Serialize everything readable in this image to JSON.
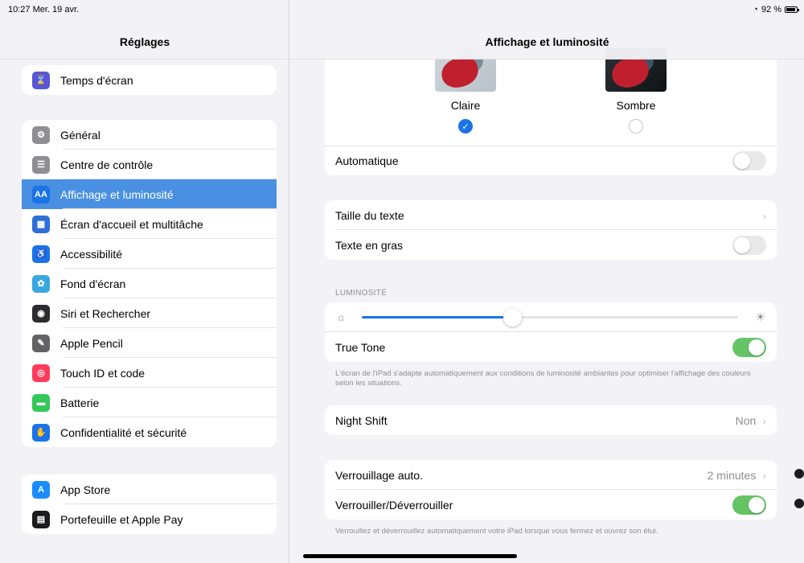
{
  "status": {
    "time": "10:27",
    "date": "Mer. 19 avr.",
    "battery": "92 %"
  },
  "sidebar": {
    "title": "Réglages",
    "groups": [
      {
        "items": [
          {
            "label": "Temps d'écran",
            "icon": "hourglass-icon",
            "color": "#5856d6",
            "glyph": "⌛"
          }
        ]
      },
      {
        "items": [
          {
            "label": "Général",
            "icon": "gear-icon",
            "color": "#8e8e93",
            "glyph": "⚙"
          },
          {
            "label": "Centre de contrôle",
            "icon": "control-center-icon",
            "color": "#8e8e93",
            "glyph": "☰"
          },
          {
            "label": "Affichage et luminosité",
            "icon": "display-icon",
            "color": "#1a73e8",
            "glyph": "AA"
          },
          {
            "label": "Écran d'accueil et multitâche",
            "icon": "home-screen-icon",
            "color": "#2f6fd8",
            "glyph": "▦"
          },
          {
            "label": "Accessibilité",
            "icon": "accessibility-icon",
            "color": "#1a73e8",
            "glyph": "♿"
          },
          {
            "label": "Fond d'écran",
            "icon": "wallpaper-icon",
            "color": "#3aa8e0",
            "glyph": "✿"
          },
          {
            "label": "Siri et Rechercher",
            "icon": "siri-icon",
            "color": "#2c2c2e",
            "glyph": "◉"
          },
          {
            "label": "Apple Pencil",
            "icon": "pencil-icon",
            "color": "#636366",
            "glyph": "✎"
          },
          {
            "label": "Touch ID et code",
            "icon": "fingerprint-icon",
            "color": "#ff3b5c",
            "glyph": "◎"
          },
          {
            "label": "Batterie",
            "icon": "battery-icon",
            "color": "#34c759",
            "glyph": "▬"
          },
          {
            "label": "Confidentialité et sécurité",
            "icon": "privacy-hand-icon",
            "color": "#1a73e8",
            "glyph": "✋"
          }
        ]
      },
      {
        "items": [
          {
            "label": "App Store",
            "icon": "app-store-icon",
            "color": "#1a8cff",
            "glyph": "A"
          },
          {
            "label": "Portefeuille et Apple Pay",
            "icon": "wallet-icon",
            "color": "#1c1c1e",
            "glyph": "▤"
          }
        ]
      }
    ]
  },
  "main": {
    "title": "Affichage et luminosité",
    "appearance": {
      "light_label": "Claire",
      "dark_label": "Sombre",
      "selected": "light",
      "automatic_label": "Automatique",
      "automatic_on": false
    },
    "text": {
      "size_label": "Taille du texte",
      "bold_label": "Texte en gras",
      "bold_on": false
    },
    "brightness": {
      "section_label": "LUMINOSITÉ",
      "level": 0.4,
      "true_tone_label": "True Tone",
      "true_tone_on": true,
      "footnote": "L'écran de l'iPad s'adapte automatiquement aux conditions de luminosité ambiantes pour optimiser l'affichage des couleurs selon les situations."
    },
    "night_shift": {
      "label": "Night Shift",
      "value": "Non"
    },
    "lock": {
      "auto_label": "Verrouillage auto.",
      "auto_value": "2 minutes",
      "lock_unlock_label": "Verrouiller/Déverrouiller",
      "lock_unlock_on": true,
      "footnote": "Verrouillez et déverrouillez automatiquement votre iPad lorsque vous fermez et ouvrez son étui."
    }
  }
}
